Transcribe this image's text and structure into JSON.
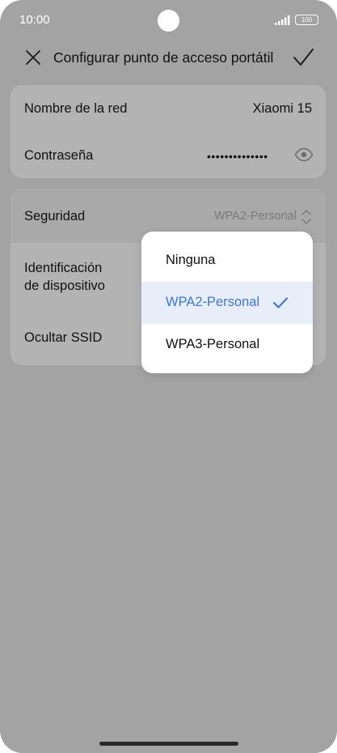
{
  "status_bar": {
    "time": "10:00",
    "battery": "100"
  },
  "header": {
    "title": "Configurar punto de acceso portátil"
  },
  "network": {
    "name_label": "Nombre de la red",
    "name_value": "Xiaomi 15",
    "password_label": "Contraseña",
    "password_value": "••••••••••••••"
  },
  "settings": {
    "security_label": "Seguridad",
    "security_value": "WPA2-Personal",
    "device_id_line1": "Identificación",
    "device_id_line2": "de dispositivo",
    "hide_ssid_label": "Ocultar SSID"
  },
  "dropdown": {
    "options": [
      {
        "label": "Ninguna",
        "selected": false
      },
      {
        "label": "WPA2-Personal",
        "selected": true
      },
      {
        "label": "WPA3-Personal",
        "selected": false
      }
    ]
  },
  "colors": {
    "accent": "#3d76d9",
    "overlay_background": "#a3a3a3",
    "selected_option_background": "#e8eef9"
  }
}
